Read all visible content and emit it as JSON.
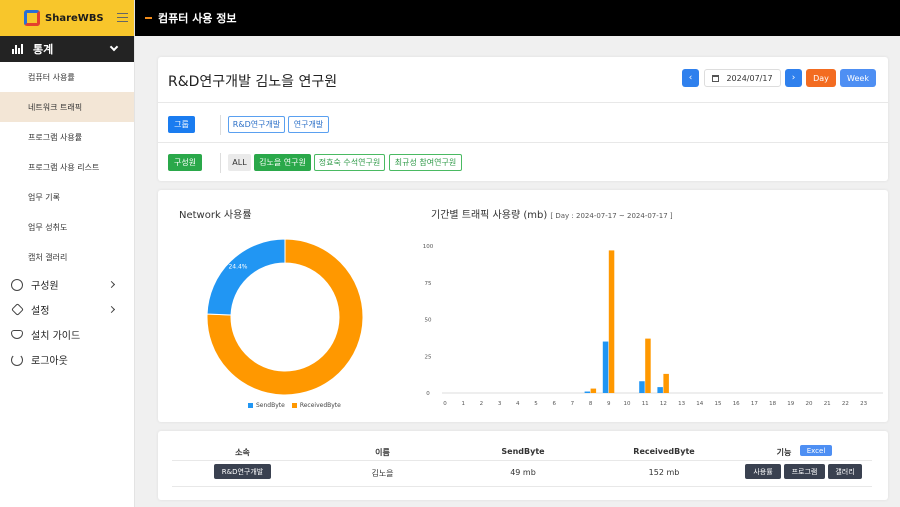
{
  "brand": {
    "name": "ShareWBS"
  },
  "topbar": {
    "title": "컴퓨터 사용 정보"
  },
  "sidebar": {
    "section": "통계",
    "sub_items": [
      "컴퓨터 사용률",
      "네트워크 트래픽",
      "프로그램 사용률",
      "프로그램 사용 리스트",
      "업무 기록",
      "업무 성취도",
      "캡처 갤러리"
    ],
    "active_index": 1,
    "items": [
      {
        "label": "구성원",
        "icon": "users-icon"
      },
      {
        "label": "설정",
        "icon": "settings-icon"
      },
      {
        "label": "설치 가이드",
        "icon": "install-guide-icon"
      },
      {
        "label": "로그아웃",
        "icon": "logout-icon"
      }
    ]
  },
  "header": {
    "title": "R&D연구개발 김노을 연구원",
    "date": "2024/07/17",
    "prev": "‹",
    "next": "›",
    "day_label": "Day",
    "week_label": "Week"
  },
  "filters": {
    "group_label": "그룹",
    "groups": [
      "R&D연구개발",
      "연구개발"
    ],
    "member_label": "구성원",
    "all_label": "ALL",
    "members": [
      "김노을 연구원",
      "정효숙 수석연구원",
      "최규성 참여연구원"
    ]
  },
  "donut": {
    "title": "Network 사용률",
    "send_label": "24.4%",
    "recv_label": "75.6%",
    "send_pct": 24.4,
    "recv_pct": 75.6,
    "legend": [
      "SendByte",
      "ReceivedByte"
    ],
    "colors": {
      "send": "#2196f3",
      "recv": "#ff9800"
    }
  },
  "chart_title": "기간별 트래픽 사용량 (mb)",
  "chart_range": "[ Day : 2024-07-17 ~ 2024-07-17 ]",
  "chart_data": {
    "type": "bar",
    "title": "기간별 트래픽 사용량 (mb)",
    "categories": [
      "0",
      "1",
      "2",
      "3",
      "4",
      "5",
      "6",
      "7",
      "8",
      "9",
      "10",
      "11",
      "12",
      "13",
      "14",
      "15",
      "16",
      "17",
      "18",
      "19",
      "20",
      "21",
      "22",
      "23"
    ],
    "series": [
      {
        "name": "SendByte",
        "color": "#2196f3",
        "values": [
          0,
          0,
          0,
          0,
          0,
          0,
          0,
          0,
          1,
          35,
          0,
          8,
          4,
          0,
          0,
          0,
          0,
          0,
          0,
          0,
          0,
          0,
          0,
          0
        ]
      },
      {
        "name": "ReceivedByte",
        "color": "#ff9800",
        "values": [
          0,
          0,
          0,
          0,
          0,
          0,
          0,
          0,
          3,
          97,
          0,
          37,
          13,
          0,
          0,
          0,
          0,
          0,
          0,
          0,
          0,
          0,
          0,
          0
        ]
      }
    ],
    "yticks": [
      0,
      25,
      50,
      75,
      100
    ],
    "ylim": [
      0,
      100
    ],
    "grid": false
  },
  "table": {
    "headers": [
      "소속",
      "이름",
      "SendByte",
      "ReceivedByte",
      "기능"
    ],
    "excel_label": "Excel",
    "row": {
      "dept": "R&D연구개발",
      "name": "김노을",
      "send": "49 mb",
      "recv": "152 mb",
      "actions": [
        "사용률",
        "프로그램",
        "갤러리"
      ]
    }
  }
}
